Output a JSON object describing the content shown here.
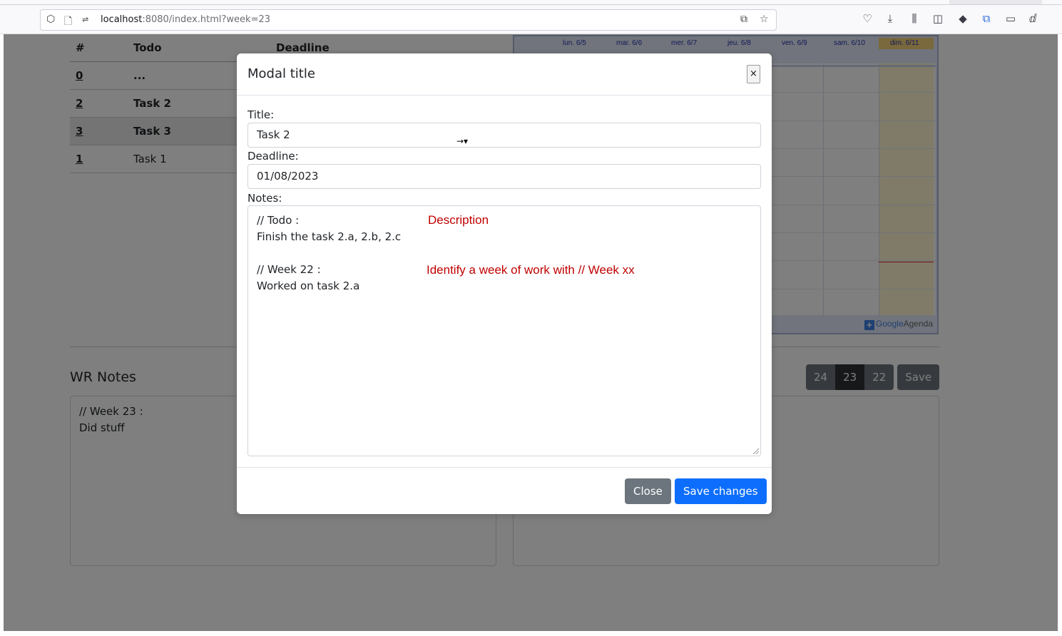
{
  "browser": {
    "url_host": "localhost",
    "url_rest": ":8080/index.html?week=23"
  },
  "todo_table": {
    "headers": [
      "#",
      "Todo",
      "Deadline"
    ],
    "rows": [
      {
        "id": "0",
        "name": "..."
      },
      {
        "id": "2",
        "name": "Task 2"
      },
      {
        "id": "3",
        "name": "Task 3"
      },
      {
        "id": "1",
        "name": "Task 1"
      }
    ]
  },
  "calendar": {
    "days": [
      "lun. 6/5",
      "mar. 6/6",
      "mer. 6/7",
      "jeu. 6/8",
      "ven. 6/9",
      "sam. 6/10",
      "dim. 6/11"
    ],
    "badge_google": "Google",
    "badge_agenda": "Agenda"
  },
  "wr": {
    "title": "WR Notes",
    "week_buttons": [
      "24",
      "23",
      "22"
    ],
    "save_label": "Save",
    "notes": "// Week 23 :\nDid stuff"
  },
  "modal": {
    "title": "Modal title",
    "close_x": "×",
    "title_label": "Title:",
    "title_value": "Task 2",
    "deadline_label": "Deadline:",
    "deadline_value": "01/08/2023",
    "notes_label": "Notes:",
    "notes_value": "// Todo :\nFinish the task 2.a, 2.b, 2.c\n\n// Week 22 :\nWorked on task 2.a",
    "annotation_description": "Description",
    "annotation_week": "Identify a week of work  with // Week xx",
    "close_label": "Close",
    "save_label": "Save changes"
  }
}
